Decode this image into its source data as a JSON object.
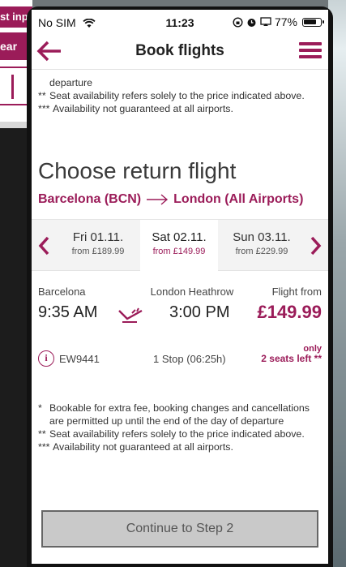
{
  "background": {
    "left_bar_text": "st input",
    "left_bar2_text": "ear"
  },
  "status_bar": {
    "carrier": "No SIM",
    "time": "11:23",
    "battery": "77%"
  },
  "header": {
    "title": "Book flights"
  },
  "notes_top": {
    "first_line": "departure",
    "items": [
      {
        "mark": "**",
        "text": "Seat availability refers solely to the price indicated above."
      },
      {
        "mark": "***",
        "text": "Availability not guaranteed at all airports."
      }
    ]
  },
  "section": {
    "heading": "Choose return flight",
    "route_from": "Barcelona (BCN)",
    "route_to": "London (All Airports)"
  },
  "dates": [
    {
      "day": "Fri 01.11.",
      "price": "from £189.99",
      "selected": false
    },
    {
      "day": "Sat 02.11.",
      "price": "from £149.99",
      "selected": true
    },
    {
      "day": "Sun 03.11.",
      "price": "from £229.99",
      "selected": false
    }
  ],
  "flight": {
    "origin": "Barcelona",
    "destination": "London Heathrow",
    "price_label": "Flight from",
    "departure_time": "9:35 AM",
    "arrival_time": "3:00 PM",
    "price": "£149.99",
    "flight_number": "EW9441",
    "stops": "1 Stop (06:25h)",
    "seats_only": "only",
    "seats_left": "2 seats left **"
  },
  "notes_bottom": {
    "items": [
      {
        "mark": "*",
        "text": "Bookable for extra fee, booking changes and cancellations are permitted up until the end of the day of departure"
      },
      {
        "mark": "**",
        "text": "Seat availability refers solely to the price indicated above."
      },
      {
        "mark": "***",
        "text": "Availability not guaranteed at all airports."
      }
    ]
  },
  "continue_label": "Continue to Step 2",
  "colors": {
    "brand": "#9b1c59",
    "button_bg": "#c9c9c9"
  }
}
